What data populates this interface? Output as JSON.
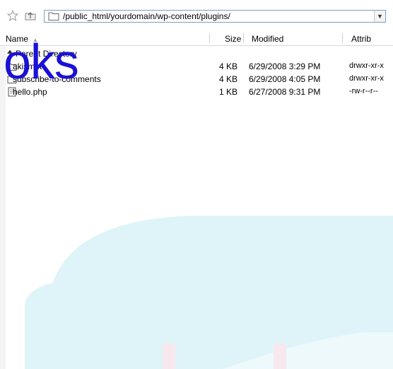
{
  "address": {
    "path": "/public_html/yourdomain/wp-content/plugins/",
    "dropdown_icon": "chevron-down-icon"
  },
  "columns": {
    "name": "Name",
    "size": "Size",
    "modified": "Modified",
    "attrib": "Attrib"
  },
  "files": [
    {
      "name": "Parent Directory",
      "size": "",
      "modified": "",
      "attrib": "",
      "icon": "up-arrow-icon"
    },
    {
      "name": "akismet",
      "size": "4 KB",
      "modified": "6/29/2008 3:29 PM",
      "attrib": "drwxr-xr-x",
      "icon": "folder-icon"
    },
    {
      "name": "subscribe-to-comments",
      "size": "4 KB",
      "modified": "6/29/2008 4:05 PM",
      "attrib": "drwxr-xr-x",
      "icon": "folder-icon"
    },
    {
      "name": "hello.php",
      "size": "1 KB",
      "modified": "6/27/2008 9:31 PM",
      "attrib": "-rw-r--r--",
      "icon": "file-icon"
    }
  ],
  "watermark": {
    "text": "oks"
  },
  "colors": {
    "watermark_text": "#1a10d6",
    "watermark_bg": "#dff4f8",
    "border": "#7f9db9"
  }
}
